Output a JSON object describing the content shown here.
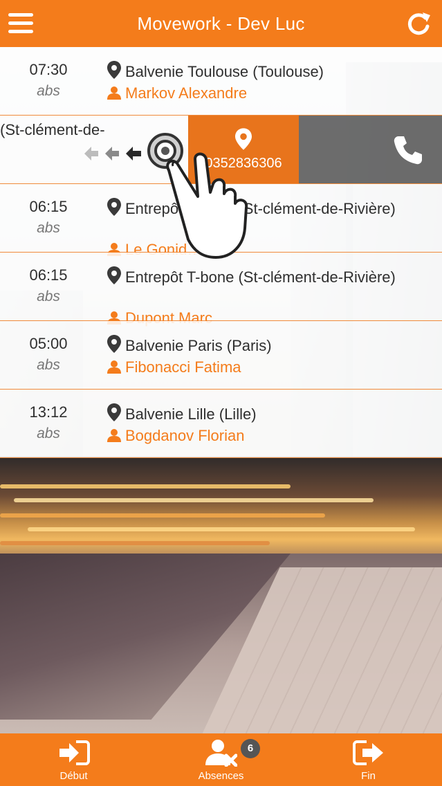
{
  "header": {
    "title": "Movework - Dev Luc",
    "menu_icon": "hamburger-menu-icon",
    "refresh_icon": "refresh-icon"
  },
  "rows": [
    {
      "time": "07:30",
      "status": "abs",
      "location": "Balvenie Toulouse (Toulouse)",
      "person": "Markov Alexandre"
    },
    {
      "location_fragment": "(St-clément-de-",
      "phone": "0352836306"
    },
    {
      "time": "06:15",
      "status": "abs",
      "location": "Entrepôt T-bone (St-clément-de-Rivière)",
      "location_visible": "Entre…e (St-clément-de-Rivière)",
      "person": "Le Gonid…a"
    },
    {
      "time": "06:15",
      "status": "abs",
      "location": "Entrepôt T-bone (St-clément-de-Rivière)",
      "person": "Dupont Marc"
    },
    {
      "time": "05:00",
      "status": "abs",
      "location": "Balvenie Paris (Paris)",
      "person": "Fibonacci Fatima"
    },
    {
      "time": "13:12",
      "status": "abs",
      "location": "Balvenie Lille (Lille)",
      "person": "Bogdanov Florian"
    }
  ],
  "tabs": [
    {
      "label": "Début",
      "icon": "sign-in-icon"
    },
    {
      "label": "Absences",
      "icon": "user-absent-icon",
      "badge": "6"
    },
    {
      "label": "Fin",
      "icon": "sign-out-icon"
    }
  ],
  "colors": {
    "accent": "#f47c1b",
    "text": "#2f2f2f",
    "muted": "#777777"
  }
}
